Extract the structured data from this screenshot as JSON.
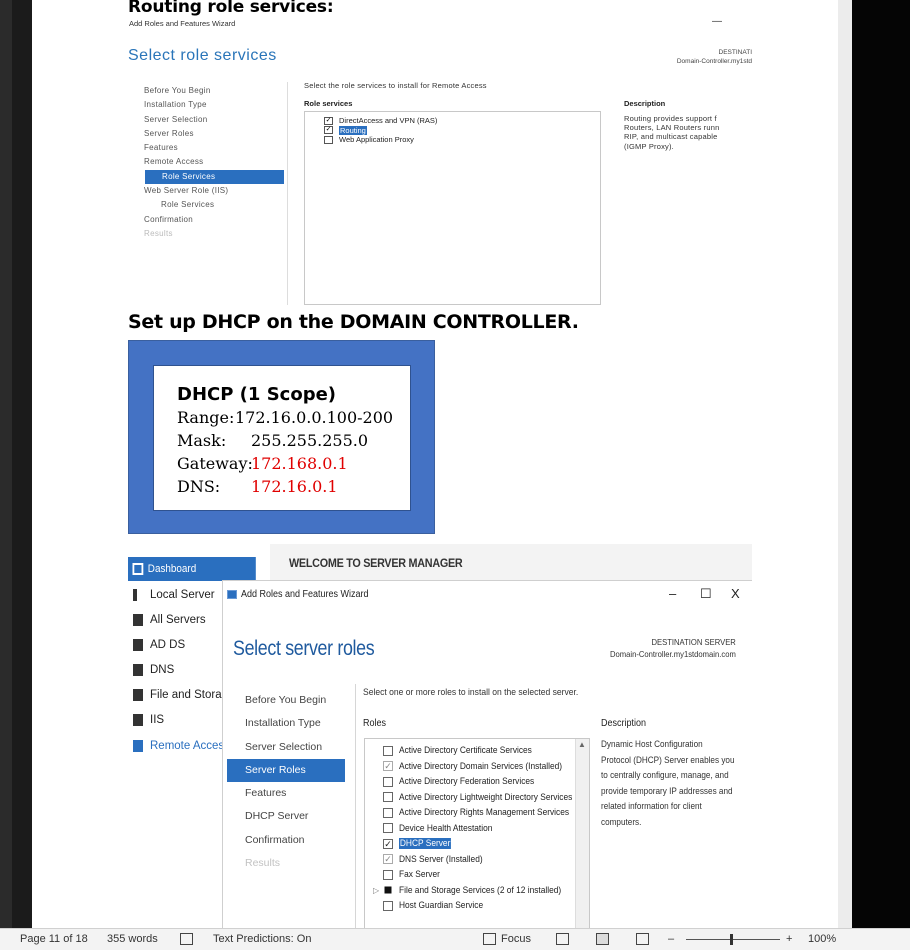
{
  "doc": {
    "heading1": "Routing role services:",
    "heading2": "Set up DHCP on the DOMAIN CONTROLLER."
  },
  "shot1": {
    "wizard_title": "Add Roles and Features Wizard",
    "minimize": "—",
    "page_title": "Select role services",
    "dest_label": "DESTINATI",
    "dest_server": "Domain-Controller.my1std",
    "nav": [
      {
        "label": "Before You Begin",
        "state": "normal"
      },
      {
        "label": "Installation Type",
        "state": "normal"
      },
      {
        "label": "Server Selection",
        "state": "normal"
      },
      {
        "label": "Server Roles",
        "state": "normal"
      },
      {
        "label": "Features",
        "state": "normal"
      },
      {
        "label": "Remote Access",
        "state": "normal"
      },
      {
        "label": "Role Services",
        "state": "selected"
      },
      {
        "label": "Web Server Role (IIS)",
        "state": "normal"
      },
      {
        "label": "Role Services",
        "state": "sub"
      },
      {
        "label": "Confirmation",
        "state": "normal"
      },
      {
        "label": "Results",
        "state": "dim"
      }
    ],
    "instruction": "Select the role services to install for Remote Access",
    "role_services_header": "Role services",
    "description_header": "Description",
    "services": [
      {
        "label": "DirectAccess and VPN (RAS)",
        "checked": true,
        "highlight": false
      },
      {
        "label": "Routing",
        "checked": true,
        "highlight": true
      },
      {
        "label": "Web Application Proxy",
        "checked": false,
        "highlight": false
      }
    ],
    "description_lines": [
      "Routing provides support f",
      "Routers, LAN Routers runn",
      "RIP, and multicast capable",
      "(IGMP Proxy)."
    ]
  },
  "dhcp": {
    "title": "DHCP  (1 Scope)",
    "range_label": "Range:",
    "range_value": "172.16.0.0.100-200",
    "mask_label": "Mask:",
    "mask_value": "255.255.255.0",
    "gateway_label": "Gateway:",
    "gateway_value": "172.168.0.1",
    "dns_label": "DNS:",
    "dns_value": "172.16.0.1"
  },
  "shot2": {
    "dashboard": "Dashboard",
    "nav": [
      {
        "label": "Local Server",
        "active": false
      },
      {
        "label": "All Servers",
        "active": false
      },
      {
        "label": "AD DS",
        "active": false
      },
      {
        "label": "DNS",
        "active": false
      },
      {
        "label": "File and Storage",
        "active": false
      },
      {
        "label": "IIS",
        "active": false
      },
      {
        "label": "Remote Access",
        "active": true
      }
    ],
    "welcome": "WELCOME TO SERVER MANAGER",
    "wizard_title": "Add Roles and Features Wizard",
    "btn_min": "–",
    "btn_max": "☐",
    "btn_close": "X",
    "page_title": "Select server roles",
    "dest_label": "DESTINATION SERVER",
    "dest_server": "Domain-Controller.my1stdomain.com",
    "steps": [
      {
        "label": "Before You Begin",
        "state": "normal"
      },
      {
        "label": "Installation Type",
        "state": "normal"
      },
      {
        "label": "Server Selection",
        "state": "normal"
      },
      {
        "label": "Server Roles",
        "state": "selected"
      },
      {
        "label": "Features",
        "state": "normal"
      },
      {
        "label": "DHCP Server",
        "state": "normal"
      },
      {
        "label": "Confirmation",
        "state": "normal"
      },
      {
        "label": "Results",
        "state": "dim"
      }
    ],
    "instruction": "Select one or more roles to install on the selected server.",
    "roles_header": "Roles",
    "description_header": "Description",
    "roles": [
      {
        "label": "Active Directory Certificate Services",
        "state": "unchecked"
      },
      {
        "label": "Active Directory Domain Services (Installed)",
        "state": "installed"
      },
      {
        "label": "Active Directory Federation Services",
        "state": "unchecked"
      },
      {
        "label": "Active Directory Lightweight Directory Services",
        "state": "unchecked"
      },
      {
        "label": "Active Directory Rights Management Services",
        "state": "unchecked"
      },
      {
        "label": "Device Health Attestation",
        "state": "unchecked"
      },
      {
        "label": "DHCP Server",
        "state": "checked-highlight"
      },
      {
        "label": "DNS Server (Installed)",
        "state": "installed"
      },
      {
        "label": "Fax Server",
        "state": "unchecked"
      },
      {
        "label": "File and Storage Services (2 of 12 installed)",
        "state": "partial"
      },
      {
        "label": "Host Guardian Service",
        "state": "unchecked"
      }
    ],
    "description_lines": [
      "Dynamic Host Configuration",
      "Protocol (DHCP) Server enables you",
      "to centrally configure, manage, and",
      "provide temporary IP addresses and",
      "related information for client",
      "computers."
    ]
  },
  "status": {
    "page": "Page 11 of 18",
    "words": "355 words",
    "predictions": "Text Predictions: On",
    "focus": "Focus",
    "zoom_minus": "–",
    "zoom_plus": "+",
    "zoom": "100%"
  }
}
